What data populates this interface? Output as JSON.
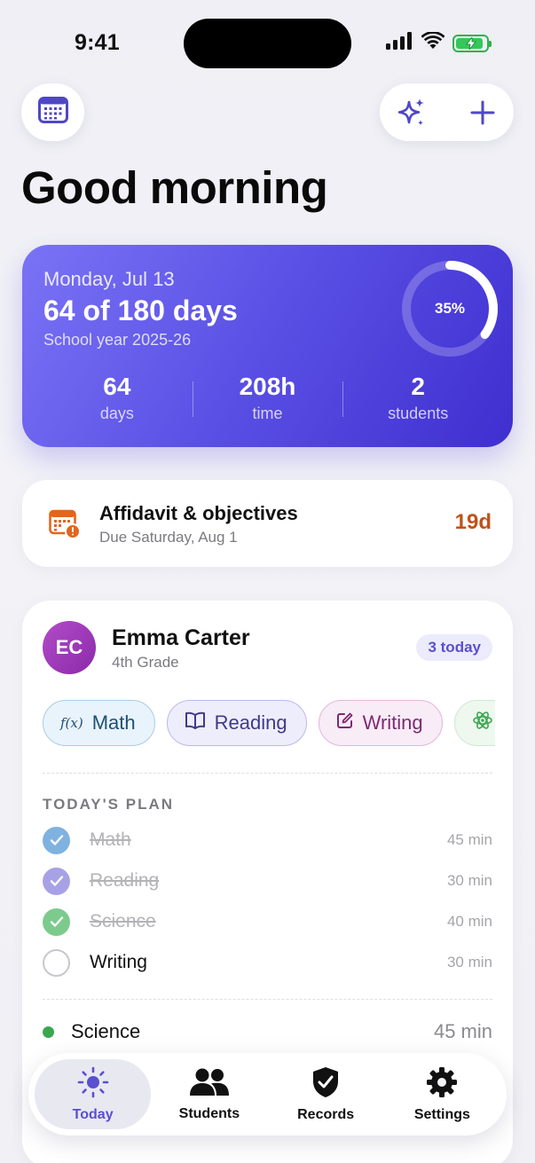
{
  "status_bar": {
    "time": "9:41"
  },
  "header": {
    "greeting": "Good morning"
  },
  "hero": {
    "date": "Monday, Jul 13",
    "days_progress": "64 of 180 days",
    "school_year": "School year 2025-26",
    "progress_label": "35%",
    "progress_fraction": 0.35,
    "stats": [
      {
        "value": "64",
        "label": "days"
      },
      {
        "value": "208h",
        "label": "time"
      },
      {
        "value": "2",
        "label": "students"
      }
    ]
  },
  "affidavit": {
    "title": "Affidavit & objectives",
    "subtitle": "Due Saturday, Aug 1",
    "countdown": "19d",
    "accent": "#c0521b"
  },
  "student": {
    "initials": "EC",
    "name": "Emma Carter",
    "grade": "4th Grade",
    "badge": "3 today",
    "subjects": [
      {
        "label": "Math",
        "icon": "function-icon"
      },
      {
        "label": "Reading",
        "icon": "book-icon"
      },
      {
        "label": "Writing",
        "icon": "edit-icon"
      },
      {
        "label": "",
        "icon": "atom-icon"
      }
    ],
    "plan_heading": "TODAY'S PLAN",
    "plan": [
      {
        "name": "Math",
        "duration": "45 min",
        "done": true,
        "color": "#7fb2e0"
      },
      {
        "name": "Reading",
        "duration": "30 min",
        "done": true,
        "color": "#a7a2e6"
      },
      {
        "name": "Science",
        "duration": "40 min",
        "done": true,
        "color": "#7ccb8d"
      },
      {
        "name": "Writing",
        "duration": "30 min",
        "done": false,
        "color": "#c8c8cc"
      }
    ],
    "next_subject": {
      "name": "Science",
      "duration": "45 min",
      "color": "#3aa74f"
    }
  },
  "tabbar": {
    "tabs": [
      {
        "label": "Today",
        "icon": "sun-icon",
        "active": true
      },
      {
        "label": "Students",
        "icon": "people-icon",
        "active": false
      },
      {
        "label": "Records",
        "icon": "shield-check-icon",
        "active": false
      },
      {
        "label": "Settings",
        "icon": "gear-icon",
        "active": false
      }
    ]
  },
  "colors": {
    "accent": "#5a4fd0",
    "hero_start": "#7a73f5",
    "hero_end": "#3f2fcf"
  }
}
